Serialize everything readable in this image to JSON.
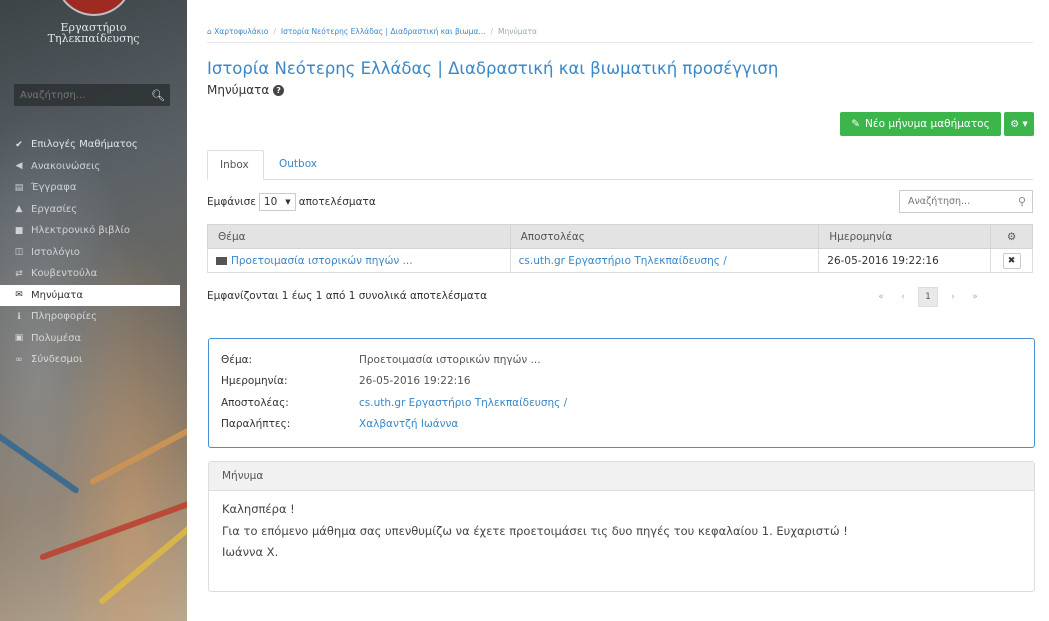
{
  "sidebar": {
    "logo_line1": "Εργαστήριο",
    "logo_line2": "Τηλεκπαίδευσης",
    "search_placeholder": "Αναζήτηση...",
    "menu": [
      {
        "label": "Επιλογές Μαθήματος",
        "icon": "chevron-down-icon"
      },
      {
        "label": "Ανακοινώσεις",
        "icon": "bullhorn-icon"
      },
      {
        "label": "Έγγραφα",
        "icon": "folder-icon"
      },
      {
        "label": "Εργασίες",
        "icon": "flask-icon"
      },
      {
        "label": "Ηλεκτρονικό βιβλίο",
        "icon": "book-icon"
      },
      {
        "label": "Ιστολόγιο",
        "icon": "columns-icon"
      },
      {
        "label": "Κουβεντούλα",
        "icon": "exchange-icon"
      },
      {
        "label": "Μηνύματα",
        "icon": "envelope-icon"
      },
      {
        "label": "Πληροφορίες",
        "icon": "info-icon"
      },
      {
        "label": "Πολυμέσα",
        "icon": "film-icon"
      },
      {
        "label": "Σύνδεσμοι",
        "icon": "link-icon"
      }
    ]
  },
  "breadcrumb": {
    "home": "Χαρτοφυλάκιο",
    "course": "Ιστορία Νεότερης Ελλάδας | Διαδραστική και βιωμα...",
    "current": "Μηνύματα"
  },
  "header": {
    "course_title": "Ιστορία Νεότερης Ελλάδας | Διαδραστική και βιωματική προσέγγιση",
    "page_title": "Μηνύματα",
    "new_message_label": "Νέο μήνυμα μαθήματος"
  },
  "tabs": {
    "inbox": "Inbox",
    "outbox": "Outbox"
  },
  "table_controls": {
    "show_label": "Εμφάνισε",
    "page_length": "10",
    "results_label": "αποτελέσματα",
    "search_placeholder": "Αναζήτηση..."
  },
  "table": {
    "columns": [
      "Θέμα",
      "Αποστολέας",
      "Ημερομηνία"
    ],
    "rows": [
      {
        "subject": "Προετοιμασία ιστορικών πηγών ...",
        "sender": "cs.uth.gr Εργαστήριο Τηλεκπαίδευσης /",
        "date": "26-05-2016 19:22:16"
      }
    ]
  },
  "table_info": "Εμφανίζονται 1 έως 1 από 1 συνολικά αποτελέσματα",
  "pagination": {
    "first": "«",
    "prev": "‹",
    "current": "1",
    "next": "›",
    "last": "»"
  },
  "details": {
    "subject_label": "Θέμα:",
    "subject": "Προετοιμασία ιστορικών πηγών ...",
    "date_label": "Ημερομηνία:",
    "date": "26-05-2016 19:22:16",
    "sender_label": "Αποστολέας:",
    "sender": "cs.uth.gr Εργαστήριο Τηλεκπαίδευσης /",
    "recipients_label": "Παραλήπτες:",
    "recipients": "Χαλβαντζή Ιωάννα"
  },
  "message": {
    "header": "Μήνυμα",
    "lines": [
      "Καλησπέρα !",
      "Για το επόμενο μάθημα σας υπενθυμίζω να έχετε προετοιμάσει τις δυο πηγές του κεφαλαίου 1. Ευχαριστώ !",
      "Ιωάννα Χ."
    ]
  },
  "colors": {
    "accent": "#3a87c8",
    "success": "#3cb54a",
    "panel_border": "#4a8fd0"
  }
}
